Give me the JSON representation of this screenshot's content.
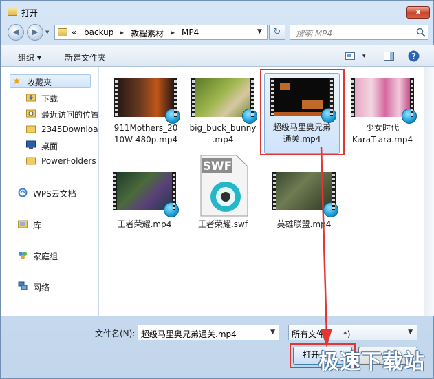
{
  "window": {
    "title": "打开",
    "close_label": "x"
  },
  "address": {
    "chevron": "«",
    "segments": [
      "backup",
      "教程素材",
      "MP4"
    ],
    "separator": "▸",
    "refresh_label": "↻"
  },
  "search": {
    "placeholder": "搜索 MP4"
  },
  "toolbar": {
    "organize": "组织 ▾",
    "new_folder": "新建文件夹",
    "view_drop": "▾",
    "help": "?"
  },
  "sidebar": {
    "items": [
      {
        "label": "收藏夹",
        "icon": "star-icon"
      },
      {
        "label": "下载",
        "icon": "download-folder-icon"
      },
      {
        "label": "最近访问的位置",
        "icon": "recent-places-icon"
      },
      {
        "label": "2345Downloa",
        "icon": "folder-icon"
      },
      {
        "label": "桌面",
        "icon": "desktop-icon"
      },
      {
        "label": "PowerFolders",
        "icon": "folder-icon"
      },
      {
        "label": "WPS云文档",
        "icon": "cloud-icon"
      },
      {
        "label": "库",
        "icon": "library-icon"
      },
      {
        "label": "家庭组",
        "icon": "homegroup-icon"
      },
      {
        "label": "网络",
        "icon": "network-icon"
      }
    ]
  },
  "files": [
    {
      "name": "911Mothers_2010W-480p.mp4",
      "line1": "911Mothers_20",
      "line2": "10W-480p.mp4",
      "kind": "video",
      "selected": false
    },
    {
      "name": "big_buck_bunny.mp4",
      "line1": "big_buck_bunny",
      "line2": ".mp4",
      "kind": "video",
      "selected": false
    },
    {
      "name": "超级马里奥兄弟通关.mp4",
      "line1": "超级马里奥兄弟",
      "line2": "通关.mp4",
      "kind": "video",
      "selected": true
    },
    {
      "name": "少女时代KaraT-ara.mp4",
      "line1": "少女时代",
      "line2": "KaraT-ara.mp4",
      "kind": "video",
      "selected": false
    },
    {
      "name": "王者荣耀.mp4",
      "line1": "王者荣耀.mp4",
      "line2": "",
      "kind": "video",
      "selected": false
    },
    {
      "name": "王者荣耀.swf",
      "line1": "王者荣耀.swf",
      "line2": "",
      "kind": "swf",
      "badge": "SWF",
      "selected": false
    },
    {
      "name": "英雄联盟.mp4",
      "line1": "英雄联盟.mp4",
      "line2": "",
      "kind": "video",
      "selected": false
    }
  ],
  "footer": {
    "filename_label": "文件名(N):",
    "filename_value": "超级马里奥兄弟通关.mp4",
    "filetype_value": "所有文件(*.*)",
    "filetype_visible": "所有文件(",
    "filetype_tail": "*)",
    "open_label": "打开",
    "watermark": "极速下载站"
  },
  "colors": {
    "highlight_box": "#e43535",
    "selection": "#cfe3f9"
  }
}
